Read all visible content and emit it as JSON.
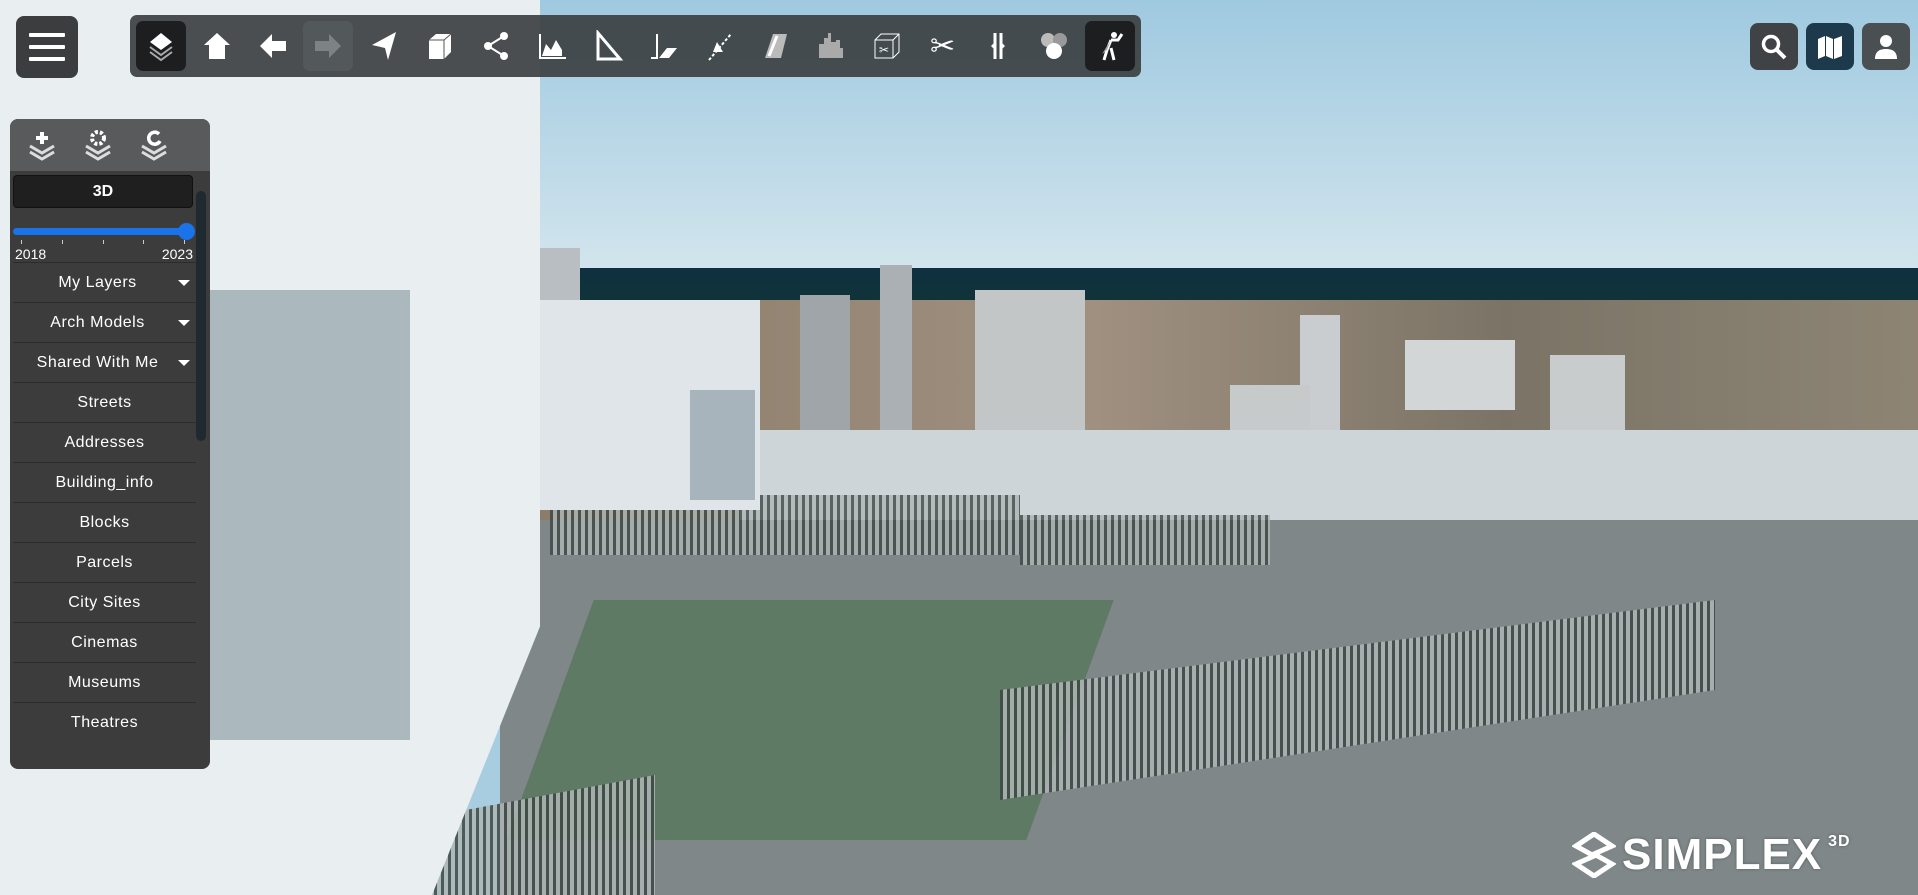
{
  "toolbar": {
    "tools": [
      {
        "name": "layers",
        "state": "active"
      },
      {
        "name": "home",
        "state": "normal"
      },
      {
        "name": "back",
        "state": "normal"
      },
      {
        "name": "forward",
        "state": "disabled"
      },
      {
        "name": "north-arrow",
        "state": "normal"
      },
      {
        "name": "box",
        "state": "normal"
      },
      {
        "name": "share",
        "state": "normal"
      },
      {
        "name": "terrain-profile",
        "state": "normal"
      },
      {
        "name": "measure",
        "state": "normal"
      },
      {
        "name": "slope",
        "state": "normal"
      },
      {
        "name": "line-of-sight",
        "state": "normal"
      },
      {
        "name": "shadow",
        "state": "normal"
      },
      {
        "name": "city-skyline",
        "state": "normal"
      },
      {
        "name": "clip-box",
        "state": "normal"
      },
      {
        "name": "scissors",
        "state": "normal"
      },
      {
        "name": "split",
        "state": "normal"
      },
      {
        "name": "viewshed",
        "state": "normal"
      },
      {
        "name": "walk-mode",
        "state": "active"
      }
    ]
  },
  "right_buttons": [
    "search-icon",
    "map-icon",
    "user-icon"
  ],
  "sidebar": {
    "top_tools": [
      "add-layer-icon",
      "layer-settings-icon",
      "refresh-layer-icon"
    ],
    "mode": "3D",
    "slider": {
      "min_label": "2018",
      "max_label": "2023",
      "value_fraction": 1.0
    },
    "items": [
      {
        "label": "My Layers",
        "dropdown": true
      },
      {
        "label": "Arch Models",
        "dropdown": true
      },
      {
        "label": "Shared With Me",
        "dropdown": true
      },
      {
        "label": "Streets"
      },
      {
        "label": "Addresses"
      },
      {
        "label": "Building_info"
      },
      {
        "label": "Blocks"
      },
      {
        "label": "Parcels"
      },
      {
        "label": "City Sites"
      },
      {
        "label": "Cinemas"
      },
      {
        "label": "Museums"
      },
      {
        "label": "Theatres"
      }
    ]
  },
  "logo": {
    "text": "SIMPLEX",
    "sup": "3D"
  },
  "colors": {
    "accent": "#1a73e8",
    "panel": "#3c3c3c",
    "map_button": "#1c3a4c"
  }
}
